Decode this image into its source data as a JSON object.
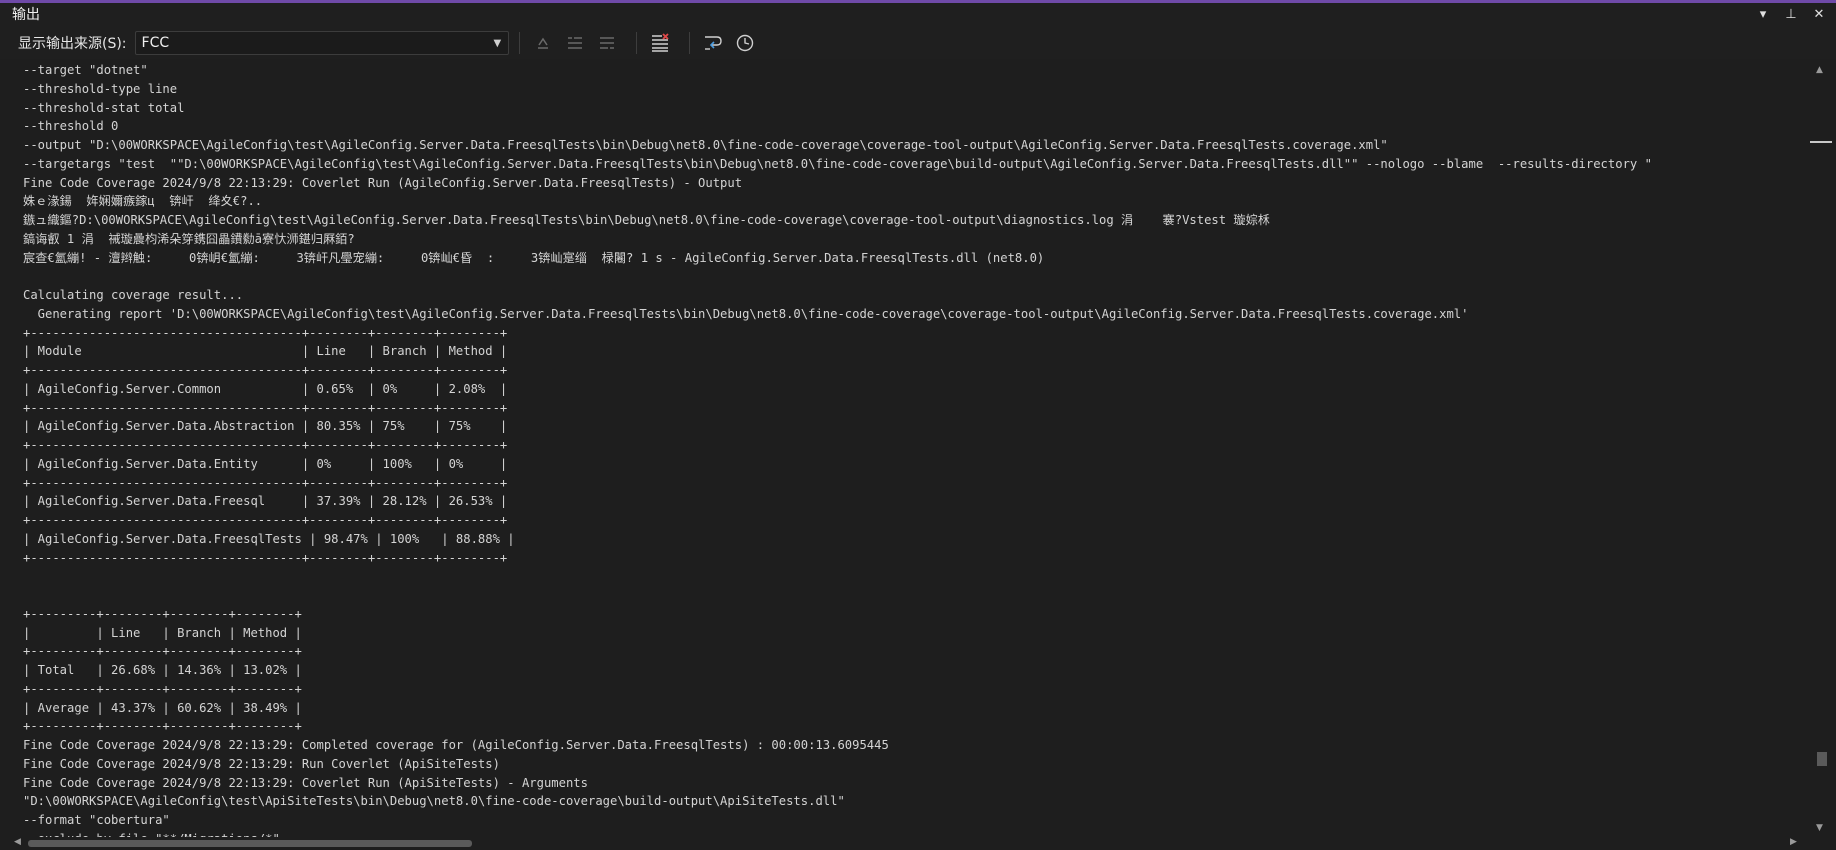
{
  "window": {
    "title": "输出",
    "controls": {
      "dropdown": "▾",
      "pin": "⊥",
      "close": "✕"
    }
  },
  "toolbar": {
    "source_label": "显示输出来源(S):",
    "source_value": "FCC",
    "icons": [
      "find-message-icon",
      "prev-message-icon",
      "next-message-icon",
      "clear-all-icon",
      "word-wrap-icon",
      "timestamp-icon"
    ]
  },
  "colors": {
    "accent": "#6f4aa8",
    "background": "#1e1e1e",
    "text": "#d4d4d4"
  },
  "log_lines": [
    "--target \"dotnet\"",
    "--threshold-type line",
    "--threshold-stat total",
    "--threshold 0",
    "--output \"D:\\00WORKSPACE\\AgileConfig\\test\\AgileConfig.Server.Data.FreesqlTests\\bin\\Debug\\net8.0\\fine-code-coverage\\coverage-tool-output\\AgileConfig.Server.Data.FreesqlTests.coverage.xml\"",
    "--targetargs \"test  \"\"D:\\00WORKSPACE\\AgileConfig\\test\\AgileConfig.Server.Data.FreesqlTests\\bin\\Debug\\net8.0\\fine-code-coverage\\build-output\\AgileConfig.Server.Data.FreesqlTests.dll\"\" --nologo --blame  --results-directory \"",
    "Fine Code Coverage 2024/9/8 22:13:29: Coverlet Run (AgileConfig.Server.Data.FreesqlTests) - Output",
    "姝ｅ湪鍚  姩娴嬭瘯鎵ц  锛屽  绛夊€?..",
    "鏃ュ織鏂?D:\\00WORKSPACE\\AgileConfig\\test\\AgileConfig.Server.Data.FreesqlTests\\bin\\Debug\\net8.0\\fine-code-coverage\\coverage-tool-output\\diagnostics.log 涓    褰?Vstest 璇婃柇",
    "鎬诲叡 1 涓  祴璇曟枃浠朵笌鎸囧畾鐨勬ā寮忕浉鍖归厤銆?",
    "宸查€氳繃! - 澶辫触:     0锛岄€氳繃:     3锛屽凡璺宠繃:     0锛屾€昏  :     3锛屾寔缁  椂闂? 1 s - AgileConfig.Server.Data.FreesqlTests.dll (net8.0)",
    "",
    "Calculating coverage result...",
    "  Generating report 'D:\\00WORKSPACE\\AgileConfig\\test\\AgileConfig.Server.Data.FreesqlTests\\bin\\Debug\\net8.0\\fine-code-coverage\\coverage-tool-output\\AgileConfig.Server.Data.FreesqlTests.coverage.xml'",
    "+-------------------------------------+--------+--------+--------+",
    "| Module                              | Line   | Branch | Method |",
    "+-------------------------------------+--------+--------+--------+",
    "| AgileConfig.Server.Common           | 0.65%  | 0%     | 2.08%  |",
    "+-------------------------------------+--------+--------+--------+",
    "| AgileConfig.Server.Data.Abstraction | 80.35% | 75%    | 75%    |",
    "+-------------------------------------+--------+--------+--------+",
    "| AgileConfig.Server.Data.Entity      | 0%     | 100%   | 0%     |",
    "+-------------------------------------+--------+--------+--------+",
    "| AgileConfig.Server.Data.Freesql     | 37.39% | 28.12% | 26.53% |",
    "+-------------------------------------+--------+--------+--------+",
    "| AgileConfig.Server.Data.FreesqlTests | 98.47% | 100%   | 88.88% |",
    "+-------------------------------------+--------+--------+--------+",
    "",
    "",
    "+---------+--------+--------+--------+",
    "|         | Line   | Branch | Method |",
    "+---------+--------+--------+--------+",
    "| Total   | 26.68% | 14.36% | 13.02% |",
    "+---------+--------+--------+--------+",
    "| Average | 43.37% | 60.62% | 38.49% |",
    "+---------+--------+--------+--------+",
    "Fine Code Coverage 2024/9/8 22:13:29: Completed coverage for (AgileConfig.Server.Data.FreesqlTests) : 00:00:13.6095445",
    "Fine Code Coverage 2024/9/8 22:13:29: Run Coverlet (ApiSiteTests)",
    "Fine Code Coverage 2024/9/8 22:13:29: Coverlet Run (ApiSiteTests) - Arguments",
    "\"D:\\00WORKSPACE\\AgileConfig\\test\\ApiSiteTests\\bin\\Debug\\net8.0\\fine-code-coverage\\build-output\\ApiSiteTests.dll\"",
    "--format \"cobertura\"",
    "--exclude-by-file \"**/Migrations/*\""
  ]
}
